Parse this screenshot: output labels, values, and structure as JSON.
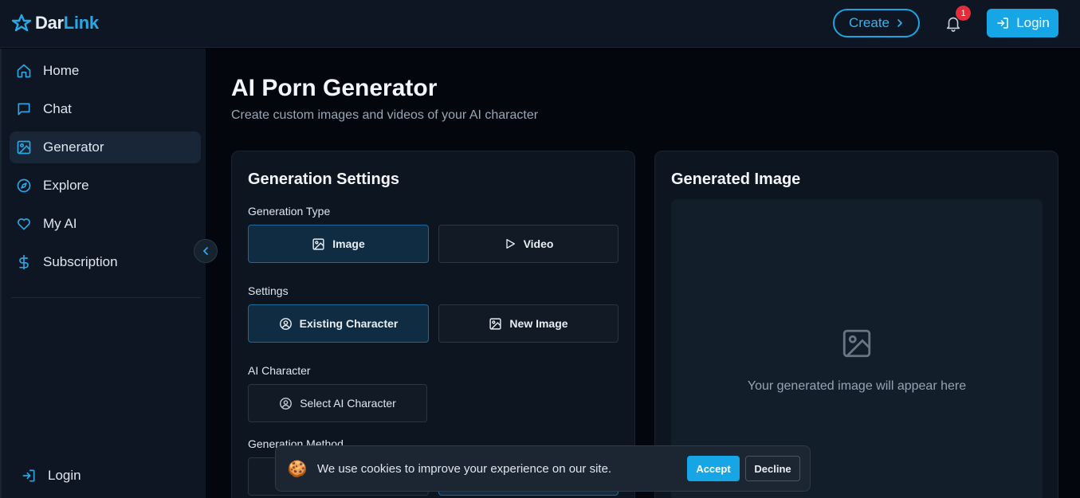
{
  "header": {
    "logo_part1": "Dar",
    "logo_part2": "Link",
    "create_label": "Create",
    "notification_count": "1",
    "login_label": "Login"
  },
  "sidebar": {
    "items": [
      {
        "label": "Home",
        "icon": "home-icon",
        "active": false
      },
      {
        "label": "Chat",
        "icon": "chat-icon",
        "active": false
      },
      {
        "label": "Generator",
        "icon": "image-icon",
        "active": true
      },
      {
        "label": "Explore",
        "icon": "compass-icon",
        "active": false
      },
      {
        "label": "My AI",
        "icon": "heart-icon",
        "active": false
      },
      {
        "label": "Subscription",
        "icon": "dollar-icon",
        "active": false
      }
    ],
    "login_label": "Login"
  },
  "main": {
    "title": "AI Porn Generator",
    "subtitle": "Create custom images and videos of your AI character"
  },
  "settings_panel": {
    "title": "Generation Settings",
    "generation_type_label": "Generation Type",
    "type_options": [
      {
        "label": "Image",
        "icon": "image-icon",
        "active": true
      },
      {
        "label": "Video",
        "icon": "play-icon",
        "active": false
      }
    ],
    "settings_label": "Settings",
    "settings_options": [
      {
        "label": "Existing Character",
        "icon": "user-circle-icon",
        "active": true
      },
      {
        "label": "New Image",
        "icon": "image-icon",
        "active": false
      }
    ],
    "ai_character_label": "AI Character",
    "select_character_label": "Select AI Character",
    "generation_method_label": "Generation Method"
  },
  "preview_panel": {
    "title": "Generated Image",
    "placeholder": "Your generated image will appear here"
  },
  "cookie_banner": {
    "text": "We use cookies to improve your experience on our site.",
    "emoji": "🍪",
    "accept_label": "Accept",
    "decline_label": "Decline"
  },
  "colors": {
    "accent": "#16a6e6",
    "background": "#03070d",
    "sidebar": "#0d1622",
    "badge": "#e32d3a"
  }
}
